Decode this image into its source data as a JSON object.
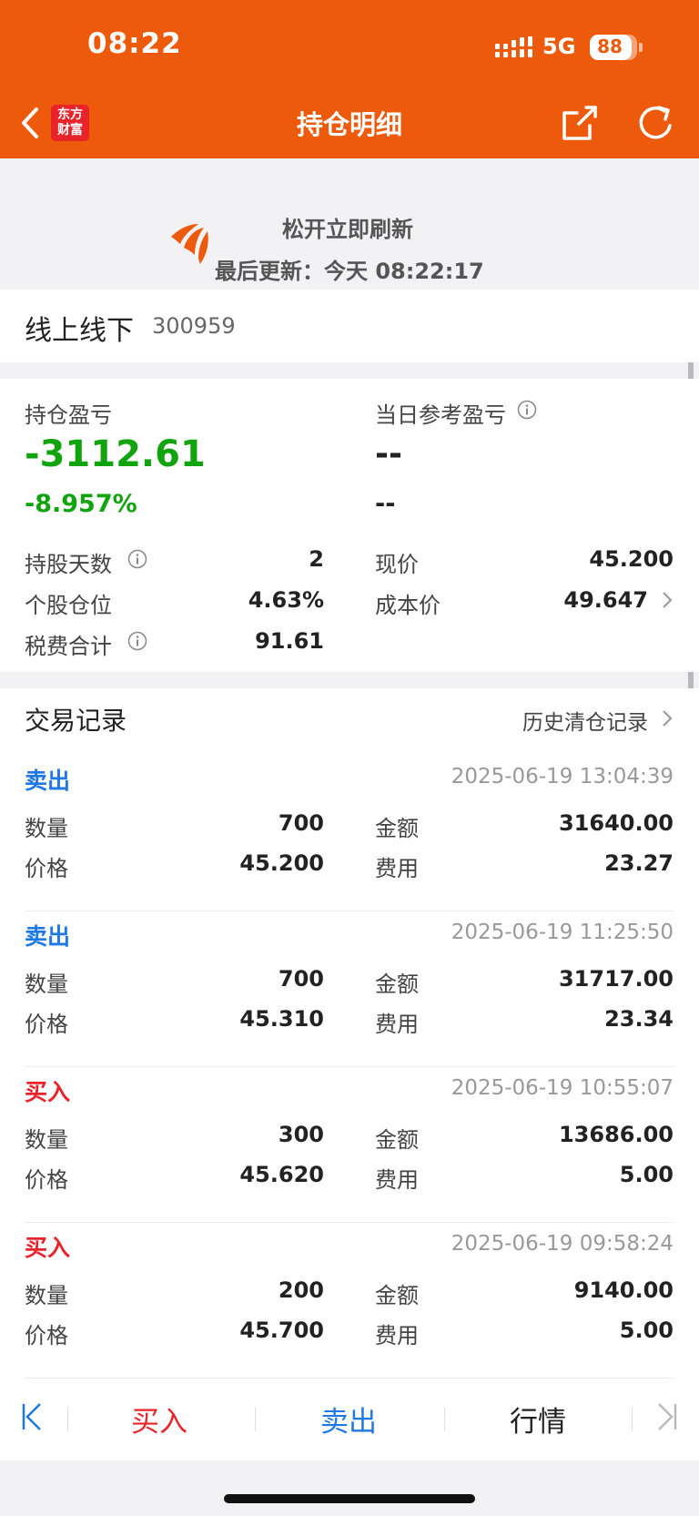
{
  "status_bar": {
    "time": "08:22",
    "network": "5G",
    "battery": "88",
    "battery_level": 0.88
  },
  "nav": {
    "brand_line1": "东方",
    "brand_line2": "财富",
    "title": "持仓明细"
  },
  "pull_refresh": {
    "title": "松开立即刷新",
    "last_update": "最后更新：今天 08:22:17"
  },
  "stock": {
    "name": "线上线下",
    "code": "300959"
  },
  "summary": {
    "position_pnl_label": "持仓盈亏",
    "position_pnl": "-3112.61",
    "position_pnl_pct": "-8.957%",
    "today_pnl_label": "当日参考盈亏",
    "today_pnl": "--",
    "today_pnl_pct": "--",
    "rows": {
      "days_label": "持股天数",
      "days": "2",
      "price_label": "现价",
      "price": "45.200",
      "weight_label": "个股仓位",
      "weight": "4.63%",
      "cost_label": "成本价",
      "cost": "49.647",
      "fees_label": "税费合计",
      "fees": "91.61"
    }
  },
  "trades": {
    "title": "交易记录",
    "history_link": "历史清仓记录",
    "qty_label": "数量",
    "price_label": "价格",
    "amount_label": "金额",
    "fee_label": "费用",
    "records": [
      {
        "side": "卖出",
        "side_color": "#1e78e6",
        "time": "2025-06-19 13:04:39",
        "qty": "700",
        "price": "45.200",
        "amount": "31640.00",
        "fee": "23.27"
      },
      {
        "side": "卖出",
        "side_color": "#1e78e6",
        "time": "2025-06-19 11:25:50",
        "qty": "700",
        "price": "45.310",
        "amount": "31717.00",
        "fee": "23.34"
      },
      {
        "side": "买入",
        "side_color": "#e8232a",
        "time": "2025-06-19 10:55:07",
        "qty": "300",
        "price": "45.620",
        "amount": "13686.00",
        "fee": "5.00"
      },
      {
        "side": "买入",
        "side_color": "#e8232a",
        "time": "2025-06-19 09:58:24",
        "qty": "200",
        "price": "45.700",
        "amount": "9140.00",
        "fee": "5.00"
      }
    ]
  },
  "bottom_bar": {
    "buy": "买入",
    "sell": "卖出",
    "quote": "行情"
  },
  "colors": {
    "brand": "#ed5a0c",
    "loss": "#12a40f",
    "sell": "#1e78e6",
    "buy": "#e8232a"
  }
}
